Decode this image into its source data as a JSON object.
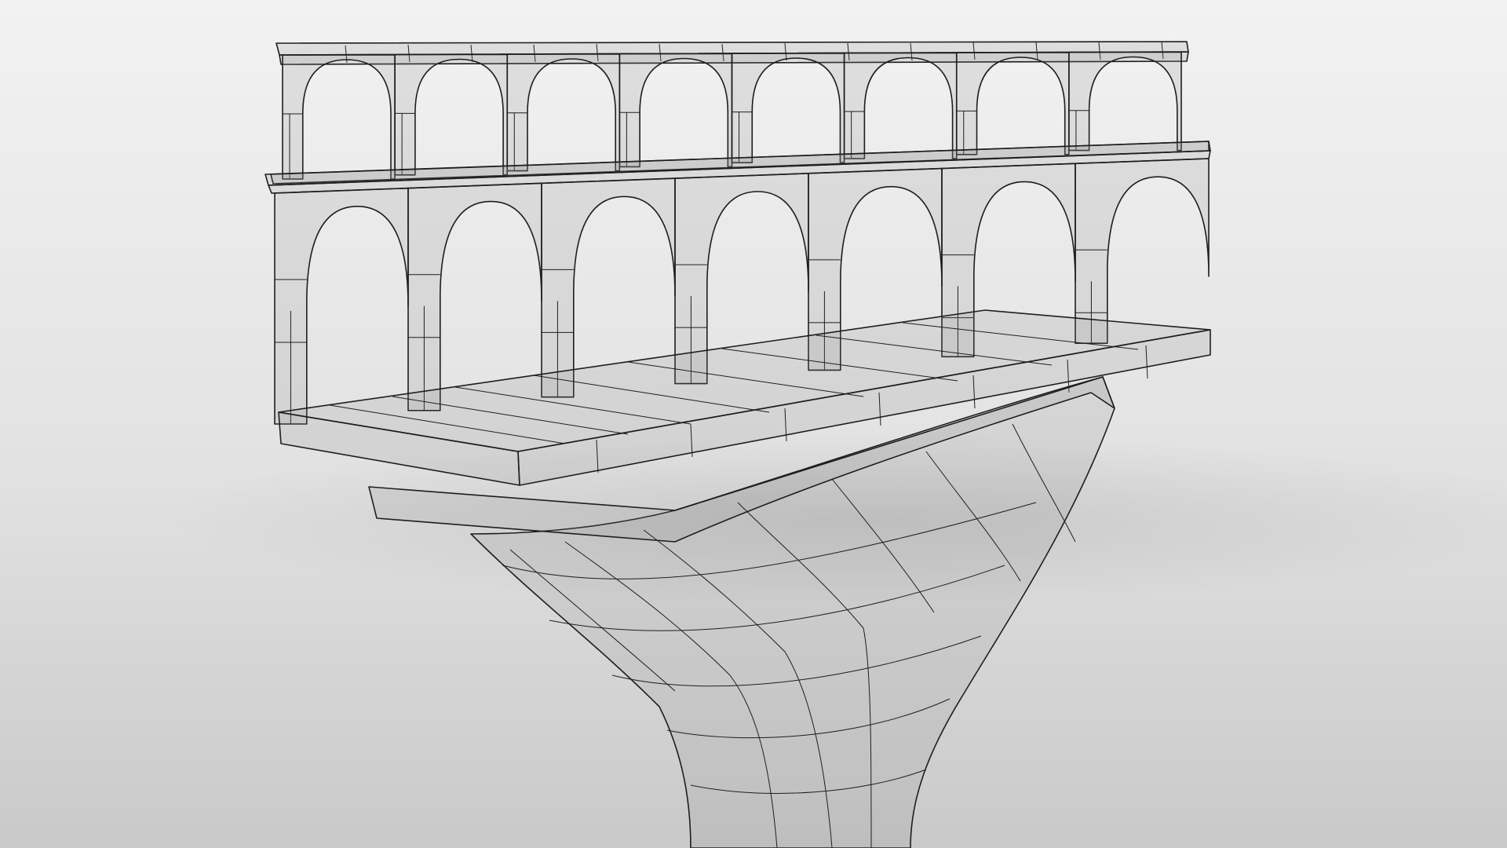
{
  "scene": {
    "subject": "aqueduct-wireframe-render",
    "render_mode": "x-ray wireframe",
    "colors": {
      "background_top": "#f2f2f2",
      "background_mid": "#e2e2e2",
      "background_bottom": "#c9c9c9",
      "horizon_shadow": "#d6d6d6",
      "wire": "#1e1e1e",
      "surface": "#8a8a8a"
    },
    "upper_tier": {
      "arch_count": 8
    },
    "middle_tier": {
      "arch_count": 7
    },
    "pier": {
      "count": 1
    }
  }
}
